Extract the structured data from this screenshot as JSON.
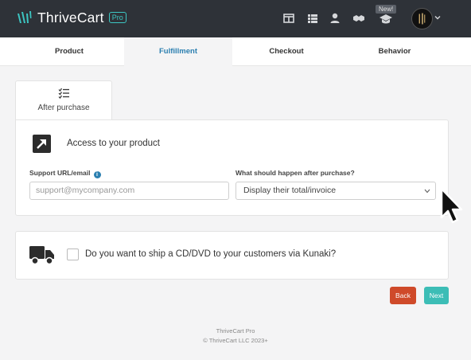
{
  "header": {
    "brand_name": "ThriveCart",
    "brand_badge": "Pro",
    "new_badge": "New!",
    "icons": [
      "layout-icon",
      "grid-icon",
      "user-icon",
      "handshake-icon",
      "graduation-cap-icon"
    ],
    "colors": {
      "topbar": "#2e3238",
      "accent": "#3cc6c2"
    }
  },
  "tabs": [
    {
      "label": "Product",
      "active": false
    },
    {
      "label": "Fulfillment",
      "active": true
    },
    {
      "label": "Checkout",
      "active": false
    },
    {
      "label": "Behavior",
      "active": false
    }
  ],
  "subtab": {
    "label": "After purchase",
    "icon": "checklist-icon"
  },
  "access_section": {
    "title": "Access to your product",
    "icon": "external-arrow-icon",
    "support_label": "Support URL/email",
    "support_placeholder": "support@mycompany.com",
    "after_label": "What should happen after purchase?",
    "after_value": "Display their total/invoice"
  },
  "shipping_section": {
    "icon": "truck-icon",
    "label": "Do you want to ship a CD/DVD to your customers via Kunaki?",
    "checked": false
  },
  "buttons": {
    "back": "Back",
    "next": "Next",
    "back_color": "#cf4a2a",
    "next_color": "#3cbdb6"
  },
  "footer": {
    "line1": "ThriveCart Pro",
    "line2": "© ThriveCart LLC 2023+"
  }
}
